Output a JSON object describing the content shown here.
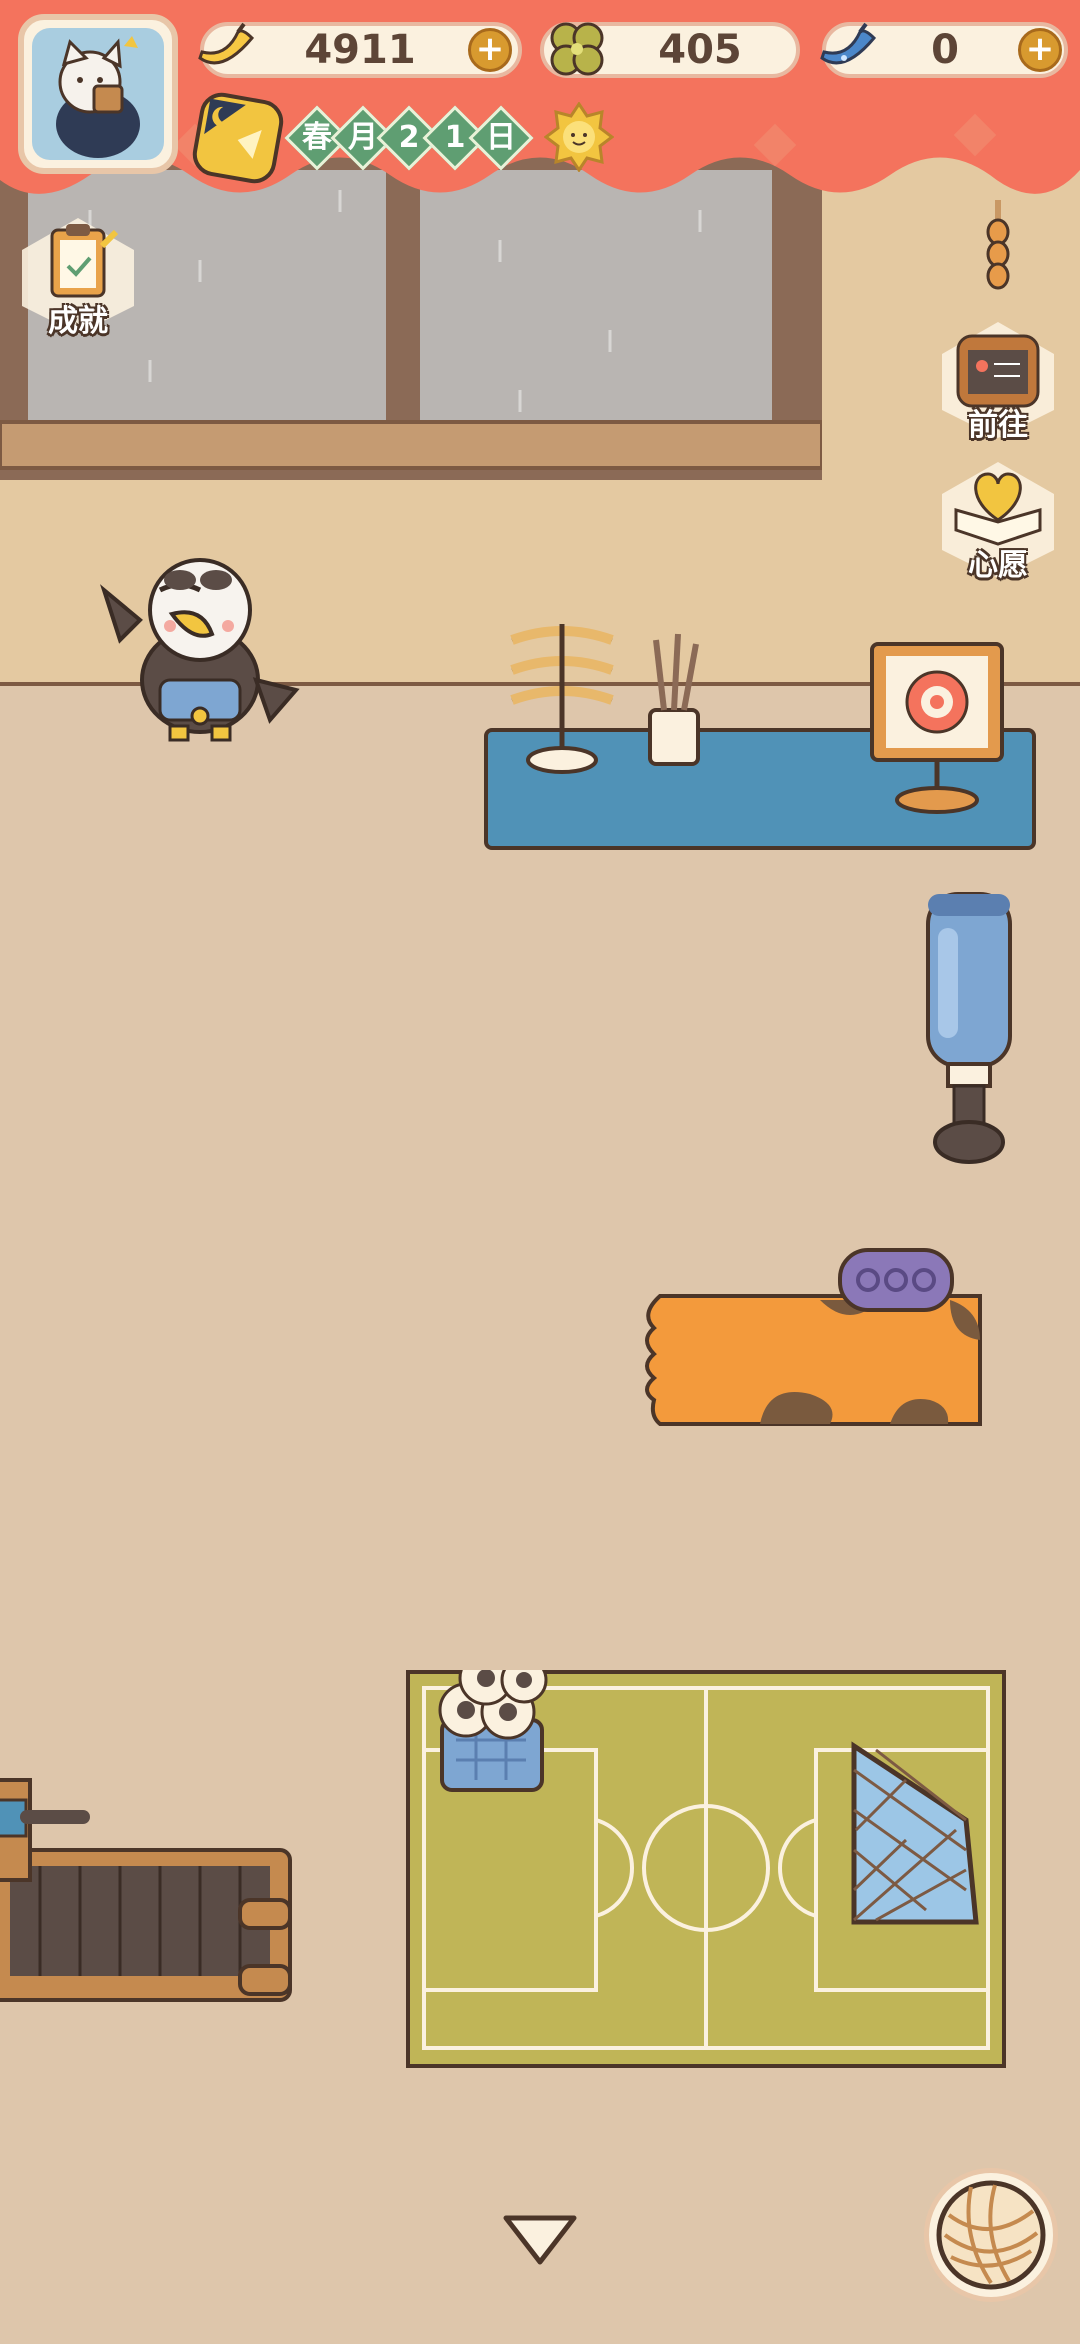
{
  "hud": {
    "banana_count": "4911",
    "clover_count": "405",
    "blue_banana_count": "0",
    "date": [
      "春",
      "月",
      "2",
      "1",
      "日"
    ]
  },
  "side_buttons": {
    "achievements": "成就",
    "go": "前往",
    "wish": "心愿"
  },
  "icons": {
    "avatar": "cat-avatar-icon",
    "banana": "banana-icon",
    "clover": "clover-icon",
    "blue_banana": "blue-banana-icon",
    "season": "moon-night-icon",
    "weather": "sun-icon",
    "yarn": "yarn-ball-icon",
    "collapse": "chevron-down-icon"
  },
  "colors": {
    "banner": "#f4735d",
    "wall": "#e4c9a1",
    "floor": "#dec6ab",
    "date_green": "#5f9e72"
  }
}
